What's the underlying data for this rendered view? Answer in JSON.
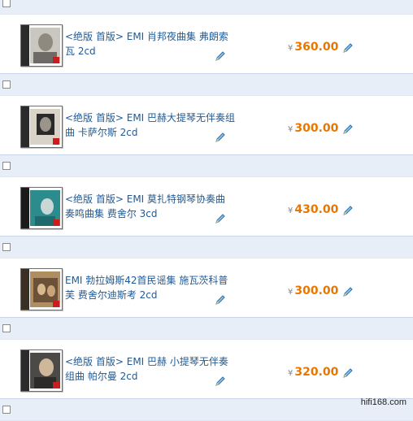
{
  "currency": "¥",
  "items": [
    {
      "title": "<绝版 首版> EMI 肖邦夜曲集 弗朗索瓦 2cd",
      "price": "360.00"
    },
    {
      "title": "<绝版 首版> EMI 巴赫大提琴无伴奏组曲 卡萨尔斯 2cd",
      "price": "300.00"
    },
    {
      "title": "<绝版 首版> EMI 莫扎特钢琴协奏曲 奏鸣曲集 费舍尔 3cd",
      "price": "430.00"
    },
    {
      "title": "EMI 勃拉姆斯42首民谣集 施瓦茨科普芙 费舍尔迪斯考 2cd",
      "price": "300.00"
    },
    {
      "title": "<绝版 首版> EMI 巴赫 小提琴无伴奏组曲 帕尔曼 2cd",
      "price": "320.00"
    }
  ],
  "watermark": "hifi168.com",
  "colors": {
    "price": "#e87700",
    "title": "#1f5a96",
    "separator": "#e8eef8"
  }
}
